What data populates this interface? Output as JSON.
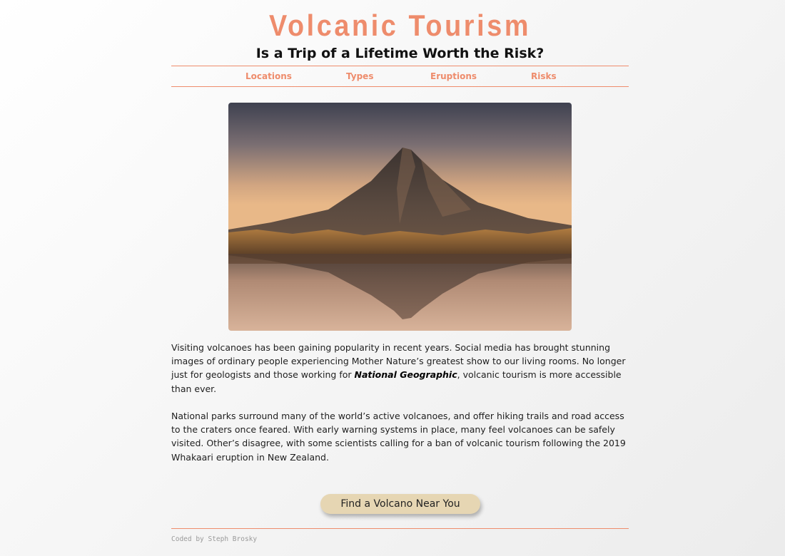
{
  "header": {
    "title": "Volcanic Tourism",
    "subtitle": "Is a Trip of a Lifetime Worth the Risk?"
  },
  "nav": {
    "items": [
      "Locations",
      "Types",
      "Eruptions",
      "Risks"
    ]
  },
  "hero_image": {
    "subject": "cone-shaped volcano at dusk reflected in a still lake"
  },
  "article": {
    "p1_before": "Visiting volcanoes has been gaining popularity in recent years. Social media has brought stunning images of ordinary people experiencing Mother Nature’s greatest show to our living rooms. No longer just for geologists and those working for ",
    "p1_emphasis": "National Geographic",
    "p1_after": ", volcanic tourism is more accessible than ever.",
    "p2": "National parks surround many of the world’s active volcanoes, and offer hiking trails and road access to the craters once feared. With early warning systems in place, many feel volcanoes can be safely visited. Other’s disagree, with some scientists calling for a ban of volcanic tourism following the 2019 Whakaari eruption in New Zealand."
  },
  "cta": {
    "label": "Find a Volcano Near You"
  },
  "footer": {
    "credit": "Coded by Steph Brosky"
  },
  "colors": {
    "accent": "#ee8c6c",
    "button": "#e6d6b3"
  }
}
